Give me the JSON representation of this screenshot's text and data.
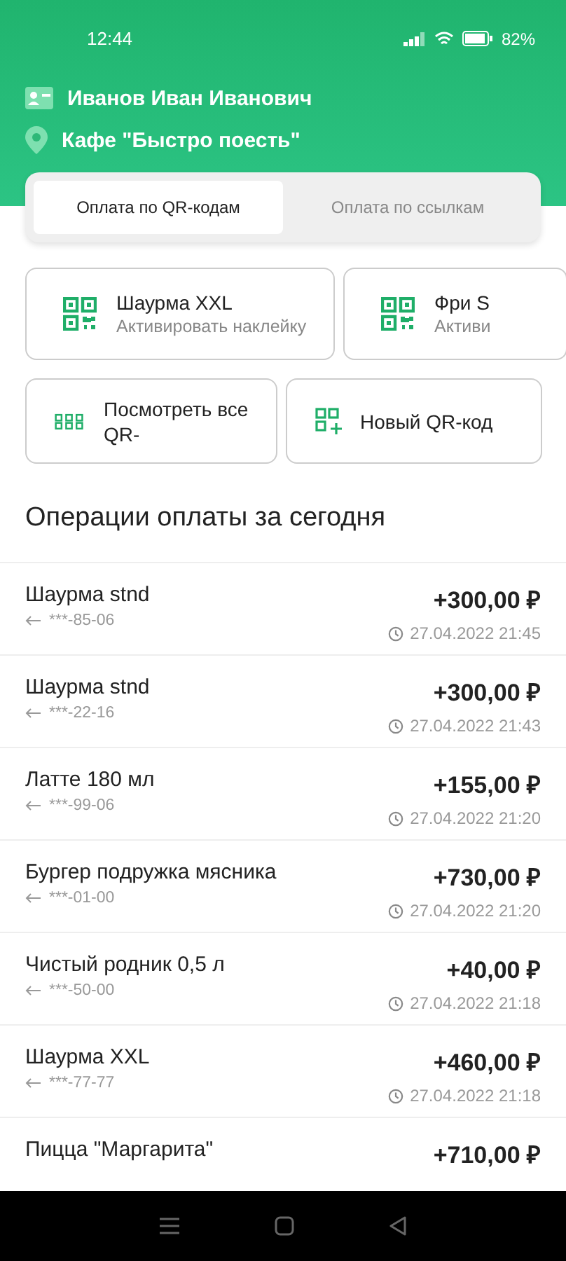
{
  "status_bar": {
    "time": "12:44",
    "battery": "82%"
  },
  "header": {
    "user": "Иванов Иван Иванович",
    "place": "Кафе \"Быстро поесть\""
  },
  "tabs": [
    {
      "label": "Оплата по QR-кодам",
      "selected": true
    },
    {
      "label": "Оплата по ссылкам",
      "selected": false
    }
  ],
  "stickers": [
    {
      "name": "Шаурма XXL",
      "action": "Активировать наклейку"
    },
    {
      "name": "Фри S",
      "action": "Активи"
    }
  ],
  "actions": [
    {
      "kind": "list",
      "label": "Посмотреть все QR-"
    },
    {
      "kind": "new",
      "label": "Новый QR-код"
    }
  ],
  "operations_title": "Операции оплаты за сегодня",
  "operations": [
    {
      "name": "Шаурма stnd",
      "phone": "***-85-06",
      "amount": "+300,00 ₽",
      "datetime": "27.04.2022 21:45"
    },
    {
      "name": "Шаурма stnd",
      "phone": "***-22-16",
      "amount": "+300,00 ₽",
      "datetime": "27.04.2022 21:43"
    },
    {
      "name": "Латте 180 мл",
      "phone": "***-99-06",
      "amount": "+155,00 ₽",
      "datetime": "27.04.2022 21:20"
    },
    {
      "name": "Бургер подружка мясника",
      "phone": "***-01-00",
      "amount": "+730,00 ₽",
      "datetime": "27.04.2022 21:20"
    },
    {
      "name": "Чистый родник 0,5 л",
      "phone": "***-50-00",
      "amount": "+40,00 ₽",
      "datetime": "27.04.2022 21:18"
    },
    {
      "name": "Шаурма XXL",
      "phone": "***-77-77",
      "amount": "+460,00 ₽",
      "datetime": "27.04.2022 21:18"
    },
    {
      "name": "Пицца \"Маргарита\"",
      "amount": "+710,00 ₽"
    }
  ]
}
